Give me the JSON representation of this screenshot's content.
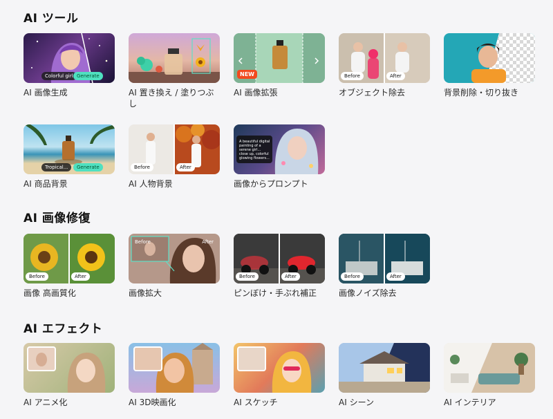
{
  "sections": [
    {
      "title": "AI ツール"
    },
    {
      "title": "AI 画像修復"
    },
    {
      "title": "AI エフェクト"
    }
  ],
  "tools": [
    {
      "label": "AI 画像生成",
      "overlay": [
        "Colorful girl",
        "Generate"
      ]
    },
    {
      "label": "AI 置き換え / 塗りつぶし",
      "overlay": []
    },
    {
      "label": "AI 画像拡張",
      "overlay": [
        "NEW"
      ]
    },
    {
      "label": "オブジェクト除去",
      "overlay": [
        "Before",
        "After"
      ]
    },
    {
      "label": "背景削除・切り抜き",
      "overlay": []
    },
    {
      "label": "AI 商品背景",
      "overlay": [
        "Tropical...",
        "Generate"
      ]
    },
    {
      "label": "AI 人物背景",
      "overlay": [
        "Before",
        "After"
      ]
    },
    {
      "label": "画像からプロンプト",
      "overlay": [
        "A beautiful digital painting of a serene girl...",
        "close up, colorful",
        "glowing flowers..."
      ]
    }
  ],
  "repair": [
    {
      "label": "画像 高画質化",
      "overlay": [
        "Before",
        "After"
      ]
    },
    {
      "label": "画像拡大",
      "overlay": [
        "Before",
        "After"
      ]
    },
    {
      "label": "ピンぼけ・手ぶれ補正",
      "overlay": [
        "Before",
        "After"
      ]
    },
    {
      "label": "画像ノイズ除去",
      "overlay": [
        "Before",
        "After"
      ]
    }
  ],
  "effects": [
    {
      "label": "AI アニメ化"
    },
    {
      "label": "AI 3D映画化"
    },
    {
      "label": "AI スケッチ"
    },
    {
      "label": "AI シーン"
    },
    {
      "label": "AI インテリア"
    }
  ],
  "colors": {
    "background": "#f5f5f7",
    "accent": "#4fe0c0",
    "new_badge": "#f24a1f"
  }
}
